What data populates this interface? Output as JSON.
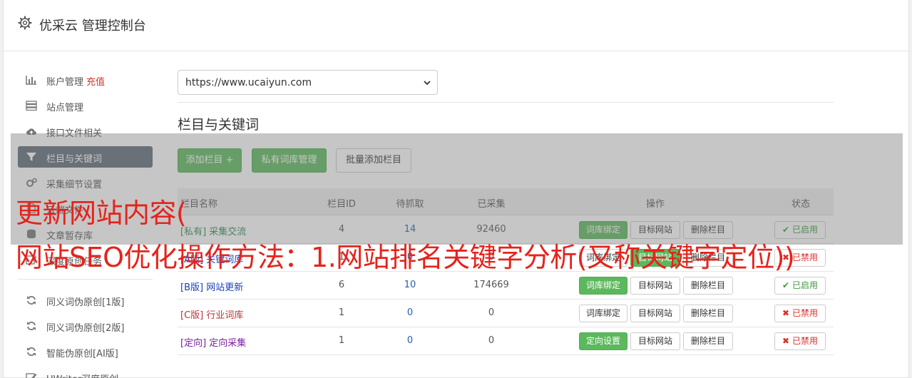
{
  "header": {
    "title": "优采云 管理控制台",
    "icon": "gear-icon"
  },
  "sidebar": {
    "items": [
      {
        "label": "账户管理",
        "extra": "充值",
        "icon": "bar-chart-icon"
      },
      {
        "label": "站点管理",
        "icon": "server-icon"
      },
      {
        "label": "接口文件相关",
        "icon": "cloud-upload-icon"
      },
      {
        "label": "栏目与关键词",
        "icon": "filter-icon",
        "active": true
      },
      {
        "label": "采集细节设置",
        "icon": "cogs-icon"
      },
      {
        "label": "云端文件",
        "icon": "file-icon"
      },
      {
        "label": "文章暂存库",
        "icon": "database-icon"
      },
      {
        "label": "深度原创任务",
        "icon": "edit-icon"
      },
      {
        "label": "同义词伪原创[1版]",
        "icon": "refresh-icon"
      },
      {
        "label": "同义词伪原创[2版]",
        "icon": "refresh-icon"
      },
      {
        "label": "智能伪原创[AI版]",
        "icon": "refresh-icon"
      },
      {
        "label": "UWriter深度原创",
        "icon": "edit-icon"
      }
    ]
  },
  "site_select": {
    "value": "https://www.ucaiyun.com"
  },
  "section_title": "栏目与关键词",
  "toolbar": {
    "add_label": "添加栏目 +",
    "private_label": "私有词库管理",
    "batch_label": "批量添加栏目"
  },
  "table": {
    "headers": [
      "栏目名称",
      "栏目ID",
      "待抓取",
      "已采集",
      "操作",
      "状态"
    ],
    "rows": [
      {
        "tag": "[私有]",
        "name": "采集交流",
        "id": "4",
        "pending": "14",
        "collected": "92460",
        "btn1": "词库绑定",
        "btn2": "目标网站",
        "btn3": "删除栏目",
        "status": "已启用",
        "on": true,
        "tag_color": "#2e8b57",
        "btn1_green": true,
        "btn2_green": false
      },
      {
        "tag": "[A版]",
        "name": "关键词库",
        "id": "1",
        "pending": "0",
        "collected": "0",
        "btn1": "词库绑定",
        "btn2": "目标网站",
        "btn3": "删除栏目",
        "status": "已禁用",
        "on": false,
        "tag_color": "#1a3fb5",
        "btn1_green": false,
        "btn2_green": true
      },
      {
        "tag": "[B版]",
        "name": "网站更新",
        "id": "6",
        "pending": "10",
        "collected": "174669",
        "btn1": "词库绑定",
        "btn2": "目标网站",
        "btn3": "删除栏目",
        "status": "已启用",
        "on": true,
        "tag_color": "#1a3fb5",
        "btn1_green": true,
        "btn2_green": false
      },
      {
        "tag": "[C版]",
        "name": "行业词库",
        "id": "1",
        "pending": "0",
        "collected": "0",
        "btn1": "词库绑定",
        "btn2": "目标网站",
        "btn3": "删除栏目",
        "status": "已禁用",
        "on": false,
        "tag_color": "#b5363a",
        "btn1_green": false,
        "btn2_green": false
      },
      {
        "tag": "[定向]",
        "name": "定向采集",
        "id": "1",
        "pending": "0",
        "collected": "0",
        "btn1": "定向设置",
        "btn2": "目标网站",
        "btn3": "删除栏目",
        "status": "已禁用",
        "on": false,
        "tag_color": "#7b1fa2",
        "btn1_green": true,
        "btn2_green": false
      }
    ]
  },
  "watermark": {
    "line1": "更新网站内容(",
    "line2": "网站SEO优化操作方法：1.网站排名关键字分析(又称关键字定位))"
  },
  "colors": {
    "accent": "#5cb85c",
    "sidebar_active": "#5f6b78",
    "watermark": "#e5231b"
  }
}
